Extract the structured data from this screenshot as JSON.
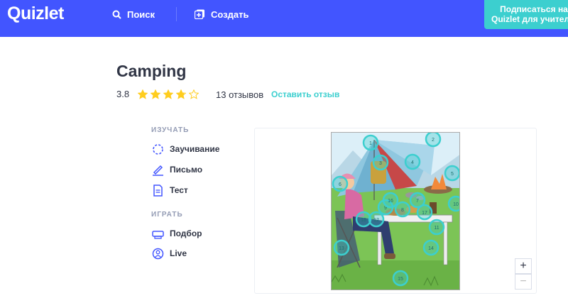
{
  "header": {
    "logo": "Quizlet",
    "search_label": "Поиск",
    "create_label": "Создать",
    "subscribe_line1": "Подписаться на",
    "subscribe_line2": "Quizlet для учителей"
  },
  "set": {
    "title": "Camping",
    "rating_value": "3.8",
    "rating_fraction": 0.76,
    "stars_total": 5,
    "reviews": "13 отзывов",
    "leave_review": "Оставить отзыв"
  },
  "sidebar": {
    "study_label": "ИЗУЧАТЬ",
    "study_items": [
      {
        "label": "Заучивание",
        "icon": "learn-icon"
      },
      {
        "label": "Письмо",
        "icon": "write-icon"
      },
      {
        "label": "Тест",
        "icon": "test-icon"
      }
    ],
    "play_label": "ИГРАТЬ",
    "play_items": [
      {
        "label": "Подбор",
        "icon": "match-icon"
      },
      {
        "label": "Live",
        "icon": "live-icon"
      }
    ]
  },
  "diagram": {
    "markers": [
      "1",
      "2",
      "3",
      "4",
      "5",
      "6",
      "7",
      "8",
      "9",
      "10",
      "11",
      "12",
      "13",
      "14",
      "15",
      "16",
      "17",
      "18"
    ],
    "zoom_in": "+",
    "zoom_out": "−"
  },
  "colors": {
    "brand": "#4255ff",
    "accent": "#3ccfcf",
    "star": "#ffcd1f",
    "text": "#303545",
    "muted": "#939bb4"
  }
}
